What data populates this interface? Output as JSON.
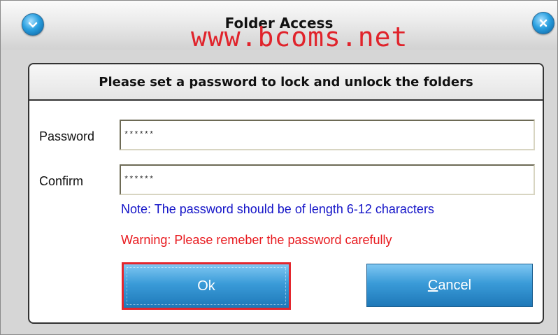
{
  "window": {
    "title": "Folder Access",
    "watermark": "www.bcoms.net"
  },
  "panel": {
    "heading": "Please set a password to lock and unlock the folders",
    "password": {
      "label": "Password",
      "value": "******"
    },
    "confirm": {
      "label": "Confirm",
      "value": "******"
    },
    "note": "Note: The password should be of length 6-12 characters",
    "warning": "Warning: Please remeber the password carefully"
  },
  "buttons": {
    "ok": "Ok",
    "cancel_mnemonic": "C",
    "cancel_rest": "ancel"
  },
  "colors": {
    "note": "#1414c8",
    "warning": "#e8191e",
    "button": "#3a9bd8",
    "focus_border": "#e4262d"
  },
  "icons": {
    "menu": "down-chevron-icon",
    "close": "close-icon"
  }
}
